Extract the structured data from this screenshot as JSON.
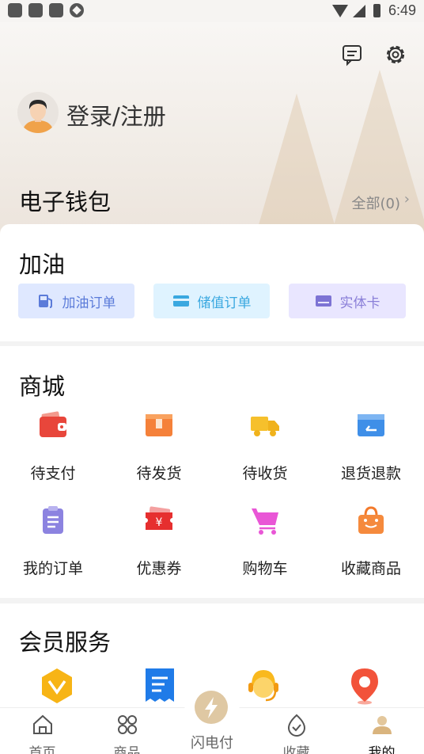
{
  "status_bar": {
    "time": "6:49"
  },
  "profile": {
    "login_label": "登录/注册"
  },
  "wallet": {
    "title": "电子钱包",
    "all_label": "全部(0)",
    "chevron": "›"
  },
  "fuel": {
    "title": "加油",
    "buttons": [
      {
        "label": "加油订单",
        "icon": "fuel-pump-icon",
        "color": "#5b7bd9"
      },
      {
        "label": "储值订单",
        "icon": "card-icon",
        "color": "#3aa8e0"
      },
      {
        "label": "实体卡",
        "icon": "physical-card-icon",
        "color": "#8a7fd8"
      }
    ]
  },
  "mall": {
    "title": "商城",
    "items": [
      {
        "label": "待支付",
        "icon": "wallet-icon"
      },
      {
        "label": "待发货",
        "icon": "box-icon"
      },
      {
        "label": "待收货",
        "icon": "truck-icon"
      },
      {
        "label": "退货退款",
        "icon": "refund-icon"
      },
      {
        "label": "我的订单",
        "icon": "clipboard-icon"
      },
      {
        "label": "优惠券",
        "icon": "coupon-icon"
      },
      {
        "label": "购物车",
        "icon": "cart-icon"
      },
      {
        "label": "收藏商品",
        "icon": "bag-icon"
      }
    ]
  },
  "member": {
    "title": "会员服务",
    "items": [
      {
        "icon": "vip-icon"
      },
      {
        "icon": "receipt-icon"
      },
      {
        "icon": "customer-service-icon"
      },
      {
        "icon": "location-icon"
      }
    ]
  },
  "nav": {
    "items": [
      {
        "label": "首页",
        "icon": "home-icon"
      },
      {
        "label": "商品",
        "icon": "grid-icon"
      },
      {
        "label": "闪电付",
        "icon": "lightning-icon"
      },
      {
        "label": "收藏",
        "icon": "favorite-icon"
      },
      {
        "label": "我的",
        "icon": "user-icon"
      }
    ],
    "active": "我的"
  }
}
